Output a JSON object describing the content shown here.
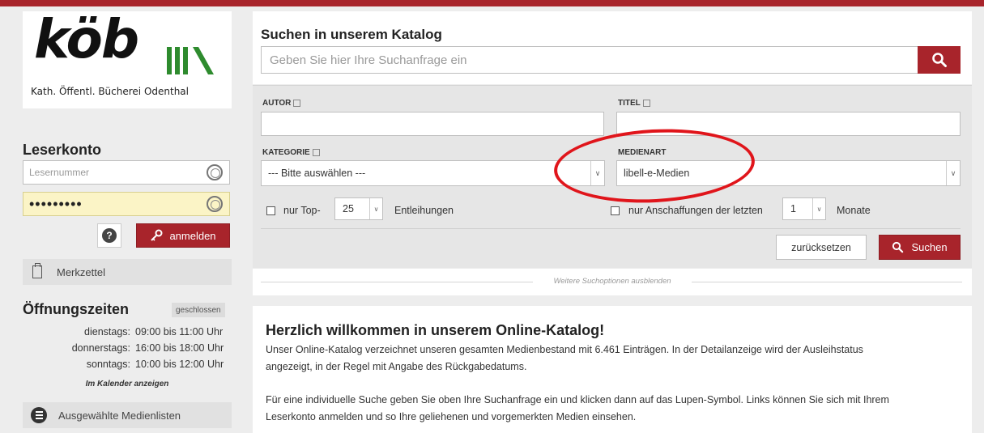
{
  "colors": {
    "brand_red": "#a8242b",
    "annotation_red": "#e0151b",
    "password_bg": "#fbf4c6",
    "logo_green": "#2e8b2e"
  },
  "logo": {
    "text": "köb",
    "subtitle": "Kath. Öffentl. Bücherei Odenthal"
  },
  "account": {
    "heading": "Leserkonto",
    "user_placeholder": "Lesernummer",
    "password_value": "•••••••••",
    "help_label": "?",
    "login_label": "anmelden",
    "icons": {
      "fingerprint": "fingerprint-icon",
      "key": "key-icon"
    }
  },
  "notepad": {
    "label": "Merkzettel",
    "icon": "clipboard-icon"
  },
  "opening": {
    "heading": "Öffnungszeiten",
    "status": "geschlossen",
    "rows": [
      {
        "day": "dienstags:",
        "time": "09:00 bis 11:00 Uhr"
      },
      {
        "day": "donnerstags:",
        "time": "16:00 bis 18:00 Uhr"
      },
      {
        "day": "sonntags:",
        "time": "10:00 bis 12:00 Uhr"
      }
    ],
    "calendar_link": "Im Kalender anzeigen"
  },
  "media_lists": {
    "label": "Ausgewählte Medienlisten",
    "icon": "list-icon"
  },
  "search": {
    "heading": "Suchen in unserem Katalog",
    "placeholder": "Geben Sie hier Ihre Suchanfrage ein",
    "icon": "search-icon"
  },
  "advanced": {
    "author_label": "AUTOR",
    "title_label": "TITEL",
    "category_label": "KATEGORIE",
    "category_value": "--- Bitte auswählen ---",
    "media_label": "MEDIENART",
    "media_value": "libell-e-Medien",
    "top_label": "nur Top-",
    "top_value": "25",
    "loans_label": "Entleihungen",
    "new_label": "nur Anschaffungen der letzten",
    "months_value": "1",
    "months_label": "Monate",
    "reset_label": "zurücksetzen",
    "search_label": "Suchen",
    "collapse_label": "Weitere Suchoptionen ausblenden"
  },
  "welcome": {
    "heading": "Herzlich willkommen in unserem Online-Katalog!",
    "p1_line1": "Unser Online-Katalog verzeichnet unseren gesamten Medienbestand mit 6.461 Einträgen. In der Detailanzeige wird der Ausleihstatus",
    "p1_line2": "angezeigt, in der Regel mit Angabe des Rückgabedatums.",
    "p2_line1": "Für eine individuelle Suche geben Sie oben Ihre Suchanfrage ein und klicken dann auf das Lupen-Symbol. Links können Sie sich mit Ihrem",
    "p2_line2": "Leserkonto anmelden und so Ihre geliehenen und vorgemerkten Medien einsehen."
  }
}
